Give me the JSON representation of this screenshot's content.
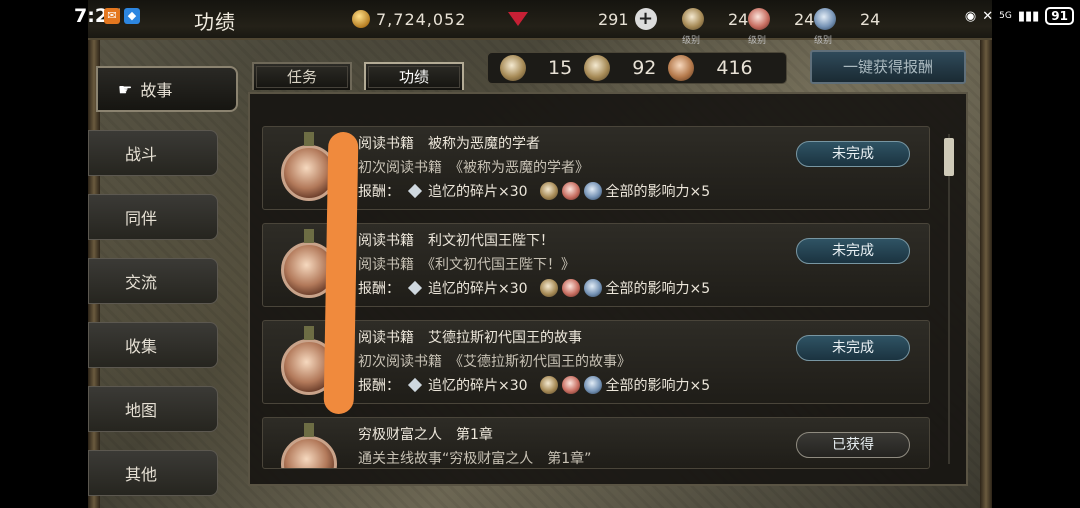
{
  "status_bar": {
    "time": "7:27",
    "signal": "5G",
    "battery": "91"
  },
  "header": {
    "title": "功绩",
    "gold": "7,724,052",
    "gems": "291",
    "medal_levels": [
      {
        "value": "24",
        "label": "级别"
      },
      {
        "value": "24",
        "label": "级别"
      },
      {
        "value": "24",
        "label": "级别"
      }
    ]
  },
  "sidebar": {
    "items": [
      {
        "label": "故事",
        "active": true
      },
      {
        "label": "战斗"
      },
      {
        "label": "同伴"
      },
      {
        "label": "交流"
      },
      {
        "label": "收集"
      },
      {
        "label": "地图"
      },
      {
        "label": "其他"
      }
    ]
  },
  "tabs": [
    {
      "label": "任务"
    },
    {
      "label": "功绩"
    }
  ],
  "counts": [
    "15",
    "92",
    "416"
  ],
  "claim_all": "一键获得报酬",
  "rows": [
    {
      "title": "阅读书籍　被称为恶魔的学者",
      "desc": "初次阅读书籍　《被称为恶魔的学者》",
      "reward_label": "报酬：",
      "reward_item": "追忆的碎片×30",
      "reward_extra": "全部的影响力×5",
      "status": "未完成"
    },
    {
      "title": "阅读书籍　利文初代国王陛下！",
      "desc": "阅读书籍　《利文初代国王陛下！》",
      "reward_label": "报酬：",
      "reward_item": "追忆的碎片×30",
      "reward_extra": "全部的影响力×5",
      "status": "未完成"
    },
    {
      "title": "阅读书籍　艾德拉斯初代国王的故事",
      "desc": "初次阅读书籍　《艾德拉斯初代国王的故事》",
      "reward_label": "报酬：",
      "reward_item": "追忆的碎片×30",
      "reward_extra": "全部的影响力×5",
      "status": "未完成"
    },
    {
      "title": "穷极财富之人　第1章",
      "desc": "通关主线故事“穷极财富之人　第1章”",
      "status": "已获得"
    }
  ]
}
